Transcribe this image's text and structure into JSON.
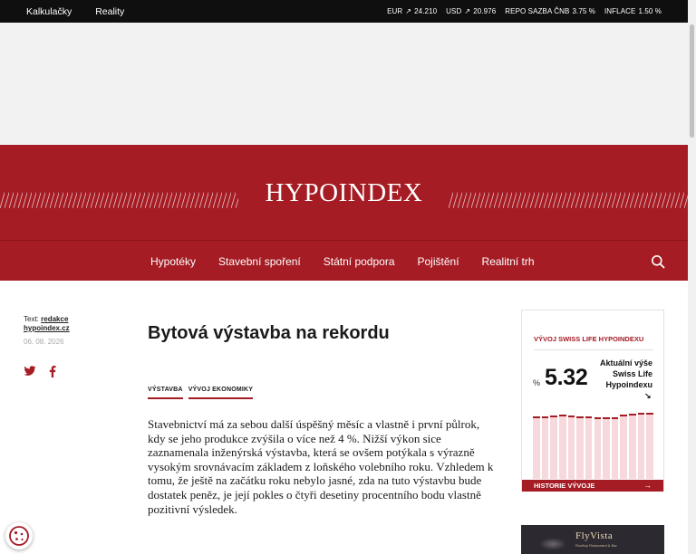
{
  "topbar": {
    "links": [
      "Kalkulačky",
      "Reality"
    ],
    "indicators": [
      {
        "label": "EUR",
        "value": "24.210",
        "arrow": "↗"
      },
      {
        "label": "USD",
        "value": "20.976",
        "arrow": "↗"
      },
      {
        "label": "REPO SAZBA ČNB",
        "value": "3.75 %",
        "arrow": ""
      },
      {
        "label": "INFLACE",
        "value": "1.50 %",
        "arrow": ""
      }
    ]
  },
  "brand": {
    "logo": "HYPOINDEX",
    "color": "#a51c24"
  },
  "nav": {
    "items": [
      "Hypotéky",
      "Stavební spoření",
      "Státní podpora",
      "Pojištění",
      "Realitní trh"
    ],
    "search_icon": "search-icon"
  },
  "meta": {
    "text_label": "Text:",
    "author": "redakce hypoindex.cz",
    "date": "06. 08. 2026"
  },
  "share": {
    "icons": [
      "twitter-icon",
      "facebook-icon"
    ]
  },
  "article": {
    "title": "Bytová výstavba na rekordu",
    "tags": [
      "VÝSTAVBA",
      "VÝVOJ EKONOMIKY"
    ],
    "lead": "Stavebnictví má za sebou další úspěšný měsíc a vlastně i první půlrok, kdy se jeho produkce zvýšila o více než 4 %. Nižší výkon sice zaznamenala inženýrská výstavba, která se ovšem potýkala s výrazně vysokým srovnávacím základem z loňského volebního roku. Vzhledem k tomu, že ještě na začátku roku nebylo jasné, zda na tuto výstavbu bude dostatek peněz, je její pokles o čtyři desetiny procentního bodu vlastně pozitivní výsledek."
  },
  "widget": {
    "title": "VÝVOJ SWISS LIFE HYPOINDEXU",
    "percent_sign": "%",
    "value": "5.32",
    "caption": "Aktuální výše Swiss Life Hypoindexu",
    "trend_arrow": "↘",
    "history_label": "HISTORIE VÝVOJE",
    "history_arrow": "→",
    "bar_levels": [
      0.84,
      0.84,
      0.85,
      0.86,
      0.85,
      0.84,
      0.84,
      0.83,
      0.83,
      0.83,
      0.87,
      0.88,
      0.89,
      0.89
    ]
  },
  "ad": {
    "logo": "FlyVista",
    "sub": "Rooftop Restaurant & Bar"
  }
}
